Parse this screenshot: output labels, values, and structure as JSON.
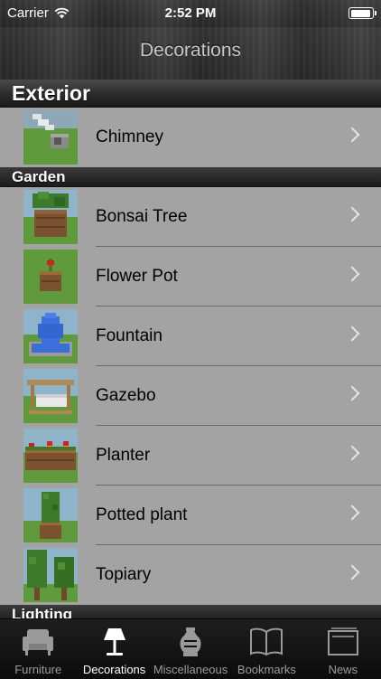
{
  "status_bar": {
    "carrier": "Carrier",
    "time": "2:52 PM"
  },
  "nav": {
    "title": "Decorations"
  },
  "sections": [
    {
      "header": "Exterior",
      "items": [
        {
          "label": "Chimney",
          "thumb": "chimney"
        }
      ]
    },
    {
      "header": "Garden",
      "items": [
        {
          "label": "Bonsai Tree",
          "thumb": "bonsai-tree"
        },
        {
          "label": "Flower Pot",
          "thumb": "flower-pot"
        },
        {
          "label": "Fountain",
          "thumb": "fountain"
        },
        {
          "label": "Gazebo",
          "thumb": "gazebo"
        },
        {
          "label": "Planter",
          "thumb": "planter"
        },
        {
          "label": "Potted plant",
          "thumb": "potted-plant"
        },
        {
          "label": "Topiary",
          "thumb": "topiary"
        }
      ]
    },
    {
      "header": "Lighting",
      "items": []
    }
  ],
  "tabs": [
    {
      "label": "Furniture",
      "icon": "armchair-icon",
      "active": false
    },
    {
      "label": "Decorations",
      "icon": "lamp-icon",
      "active": true
    },
    {
      "label": "Miscellaneous",
      "icon": "vase-icon",
      "active": false
    },
    {
      "label": "Bookmarks",
      "icon": "book-icon",
      "active": false
    },
    {
      "label": "News",
      "icon": "news-icon",
      "active": false
    }
  ],
  "colors": {
    "list_bg": "#a3a3a3",
    "header_bg": "#1c1c1c",
    "tab_active": "#ffffff",
    "tab_inactive": "#9a9a9a",
    "grass": "#5f9a3c",
    "dirt": "#7a5230"
  }
}
